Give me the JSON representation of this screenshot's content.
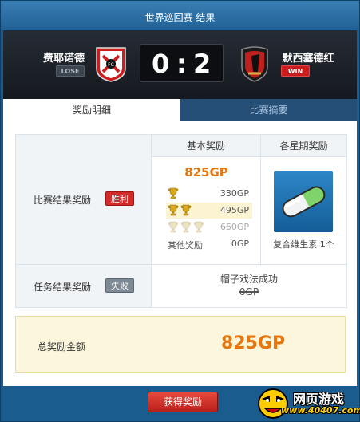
{
  "window": {
    "title": "世界巡回赛 结果"
  },
  "match": {
    "home": {
      "name": "费耶诺德",
      "result": "LOSE",
      "crest_text": "FC"
    },
    "away": {
      "name": "默西塞德红",
      "result": "WIN"
    },
    "score": {
      "home": "0",
      "separator": ":",
      "away": "2"
    }
  },
  "tabs": [
    {
      "label": "奖励明细",
      "active": true
    },
    {
      "label": "比赛摘要",
      "active": false
    }
  ],
  "rewards": {
    "match_result": {
      "label": "比赛结果奖励",
      "tag": "胜利"
    },
    "mission_result": {
      "label": "任务结果奖励",
      "tag": "失败"
    },
    "basic": {
      "header": "基本奖励",
      "total": "825GP",
      "rows": [
        {
          "trophies": 1,
          "value": "330GP",
          "highlight": false,
          "dim": false
        },
        {
          "trophies": 2,
          "value": "495GP",
          "highlight": true,
          "dim": false
        },
        {
          "trophies": 3,
          "value": "660GP",
          "highlight": false,
          "dim": true
        }
      ],
      "other": {
        "label": "其他奖励",
        "value": "0GP"
      }
    },
    "weekly": {
      "header": "各星期奖励",
      "item": "复合维生素 1个",
      "icon": "vitamin-capsule-icon"
    },
    "mission": {
      "text": "帽子戏法成功",
      "value": "0GP"
    },
    "total": {
      "label": "总奖励金额",
      "value": "825GP"
    }
  },
  "footer": {
    "claim_label": "获得奖励"
  },
  "watermark": {
    "line1": "网页游戏",
    "line2": "www.40407.com"
  },
  "colors": {
    "accent_orange": "#e7760f",
    "win_red": "#c91d1d",
    "header_blue": "#1f5f93"
  }
}
